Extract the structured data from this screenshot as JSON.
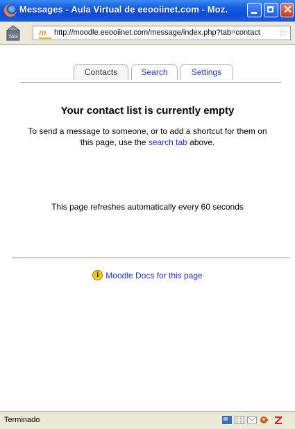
{
  "window": {
    "title": "Messages - Aula Virtual de eeooiinet.com - Moz..."
  },
  "addressbar": {
    "url": "http://moodle.eeooiinet.com/message/index.php?tab=contact"
  },
  "tabs": [
    {
      "label": "Contacts",
      "active": true
    },
    {
      "label": "Search",
      "active": false
    },
    {
      "label": "Settings",
      "active": false
    }
  ],
  "main": {
    "heading": "Your contact list is currently empty",
    "description_pre": "To send a message to someone, or to add a shortcut for them on this page, use the ",
    "description_link": "search tab",
    "description_post": " above.",
    "refresh_note": "This page refreshes automatically every 60 seconds",
    "docs_link": "Moodle Docs for this page"
  },
  "statusbar": {
    "text": "Terminado"
  },
  "colors": {
    "link": "#1a37b8",
    "titlebar": "#0a4cd8"
  }
}
